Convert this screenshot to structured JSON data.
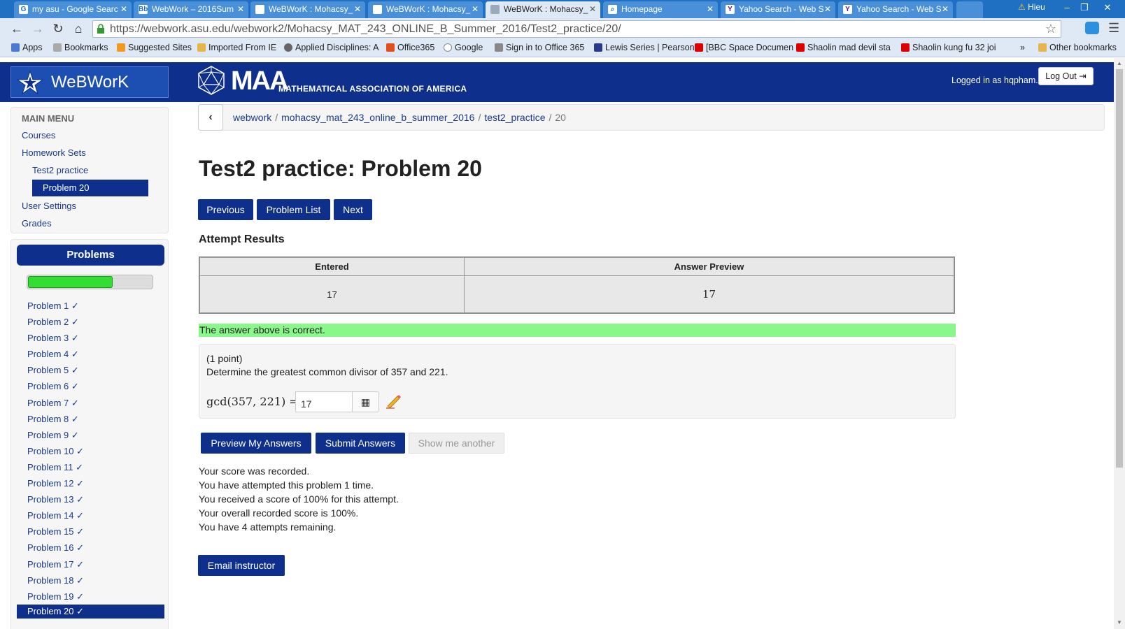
{
  "browser": {
    "tabs": [
      {
        "label": "my asu - Google Searc",
        "icon": "google-icon"
      },
      {
        "label": "WebWork – 2016Sum",
        "icon": "blackboard-icon"
      },
      {
        "label": "WeBWorK : Mohacsy_",
        "icon": "page-icon"
      },
      {
        "label": "WeBWorK : Mohacsy_",
        "icon": "page-icon"
      },
      {
        "label": "WeBWorK : Mohacsy_",
        "icon": "page-icon"
      },
      {
        "label": "Homepage",
        "icon": "search-icon"
      },
      {
        "label": "Yahoo Search - Web S",
        "icon": "yahoo-icon"
      },
      {
        "label": "Yahoo Search - Web S",
        "icon": "yahoo-icon"
      }
    ],
    "user": "Hieu",
    "url": "https://webwork.asu.edu/webwork2/Mohacsy_MAT_243_ONLINE_B_Summer_2016/Test2_practice/20/",
    "bookmarks": [
      "Apps",
      "Bookmarks",
      "Suggested Sites",
      "Imported From IE",
      "Applied Disciplines: A",
      "Office365",
      "Google",
      "Sign in to Office 365",
      "Lewis Series | Pearson",
      "[BBC Space Documen",
      "Shaolin mad devil sta",
      "Shaolin kung fu 32 joi",
      "»",
      "Other bookmarks"
    ]
  },
  "header": {
    "brand": "WeBWorK",
    "maa_word": "MAA",
    "maa_sub": "MATHEMATICAL ASSOCIATION OF AMERICA",
    "logged_in": "Logged in as hqpham.",
    "logout": "Log Out"
  },
  "mainmenu": {
    "title": "MAIN MENU",
    "courses": "Courses",
    "homework_sets": "Homework Sets",
    "set": "Test2 practice",
    "problem": "Problem 20",
    "user_settings": "User Settings",
    "grades": "Grades"
  },
  "problems_panel": {
    "title": "Problems",
    "progress": 0.69,
    "items": [
      "Problem 1 ✓",
      "Problem 2 ✓",
      "Problem 3 ✓",
      "Problem 4 ✓",
      "Problem 5 ✓",
      "Problem 6 ✓",
      "Problem 7 ✓",
      "Problem 8 ✓",
      "Problem 9 ✓",
      "Problem 10 ✓",
      "Problem 11 ✓",
      "Problem 12 ✓",
      "Problem 13 ✓",
      "Problem 14 ✓",
      "Problem 15 ✓",
      "Problem 16 ✓",
      "Problem 17 ✓",
      "Problem 18 ✓",
      "Problem 19 ✓",
      "Problem 20 ✓"
    ]
  },
  "breadcrumb": {
    "items": [
      "webwork",
      "mohacsy_mat_243_online_b_summer_2016",
      "test2_practice"
    ],
    "current": "20"
  },
  "main": {
    "title": "Test2 practice: Problem 20",
    "nav": {
      "previous": "Previous",
      "list": "Problem List",
      "next": "Next"
    },
    "attempt_heading": "Attempt Results",
    "results": {
      "col_entered": "Entered",
      "col_preview": "Answer Preview",
      "entered": "17",
      "preview": "17"
    },
    "correct_msg": "The answer above is correct.",
    "problem": {
      "points": "(1 point)",
      "question": "Determine the greatest common divisor of 357 and 221.",
      "math": "gcd(357, 221) =",
      "answer": "17"
    },
    "actions": {
      "preview": "Preview My Answers",
      "submit": "Submit Answers",
      "another": "Show me another"
    },
    "score_lines": [
      "Your score was recorded.",
      "You have attempted this problem 1 time.",
      "You received a score of 100% for this attempt.",
      "Your overall recorded score is 100%.",
      "You have 4 attempts remaining."
    ],
    "email": "Email instructor"
  },
  "colors": {
    "navy": "#0e2f8c",
    "correct_green": "#8af78a",
    "progress_green": "#33dd33"
  }
}
